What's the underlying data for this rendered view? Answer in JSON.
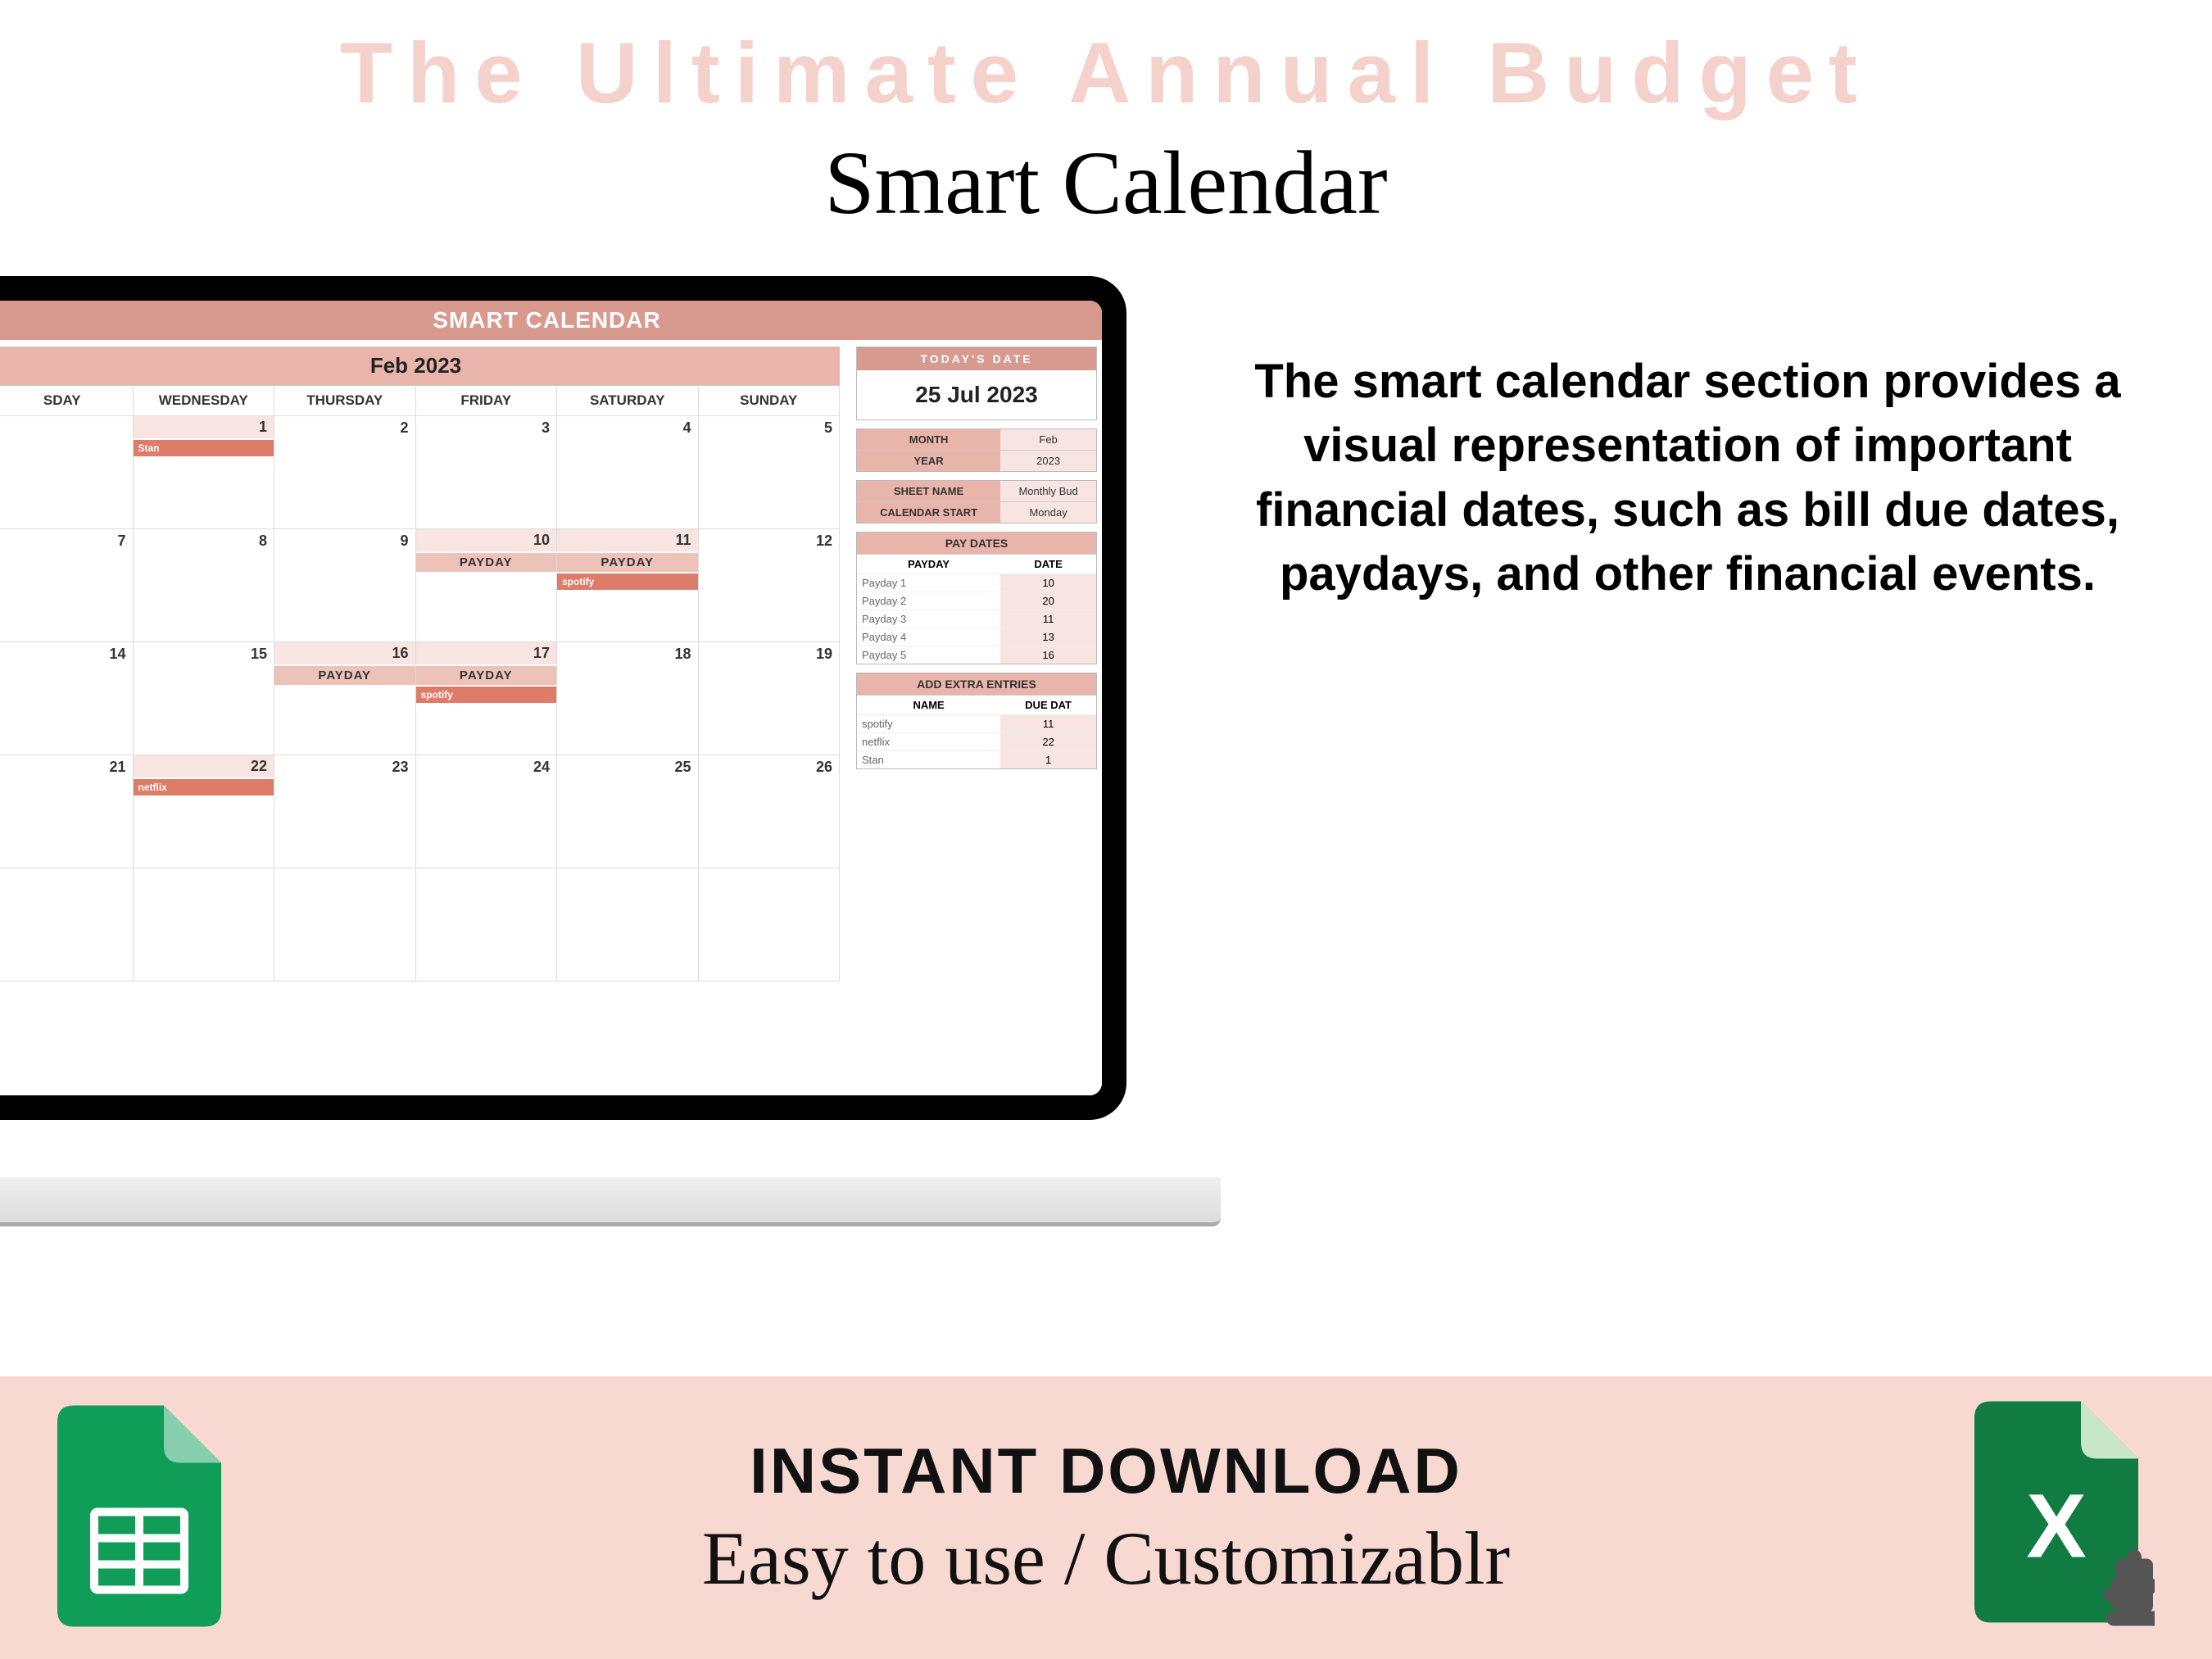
{
  "main_title": "The Ultimate Annual Budget",
  "subtitle": "Smart Calendar",
  "description": "The smart calendar section provides a visual representation of important financial dates, such as bill due dates, paydays, and other financial events.",
  "bottom": {
    "instant": "INSTANT DOWNLOAD",
    "easy": "Easy to use / Customizablr"
  },
  "calendar": {
    "banner": "SMART CALENDAR",
    "month_label": "Feb 2023",
    "day_headers": [
      "SDAY",
      "WEDNESDAY",
      "THURSDAY",
      "FRIDAY",
      "SATURDAY",
      "SUNDAY"
    ],
    "weeks": [
      [
        {
          "date": "",
          "tags": []
        },
        {
          "date": "1",
          "pink": true,
          "tags": [
            {
              "t": "Stan",
              "c": "stan"
            }
          ]
        },
        {
          "date": "2",
          "tags": []
        },
        {
          "date": "3",
          "tags": []
        },
        {
          "date": "4",
          "tags": []
        },
        {
          "date": "5",
          "tags": []
        }
      ],
      [
        {
          "date": "7",
          "tags": []
        },
        {
          "date": "8",
          "tags": []
        },
        {
          "date": "9",
          "tags": []
        },
        {
          "date": "10",
          "pink": true,
          "tags": [
            {
              "t": "PAYDAY",
              "c": "payday"
            }
          ]
        },
        {
          "date": "11",
          "pink": true,
          "tags": [
            {
              "t": "PAYDAY",
              "c": "payday"
            },
            {
              "t": "spotify",
              "c": "spotify"
            }
          ]
        },
        {
          "date": "12",
          "tags": []
        }
      ],
      [
        {
          "date": "14",
          "tags": []
        },
        {
          "date": "15",
          "tags": []
        },
        {
          "date": "16",
          "pink": true,
          "tags": [
            {
              "t": "PAYDAY",
              "c": "payday"
            }
          ]
        },
        {
          "date": "17",
          "pink": true,
          "tags": [
            {
              "t": "PAYDAY",
              "c": "payday"
            },
            {
              "t": "spotify",
              "c": "spotify"
            }
          ]
        },
        {
          "date": "18",
          "tags": []
        },
        {
          "date": "19",
          "tags": []
        }
      ],
      [
        {
          "date": "21",
          "tags": []
        },
        {
          "date": "22",
          "pink": true,
          "tags": [
            {
              "t": "netflix",
              "c": "netflix"
            }
          ]
        },
        {
          "date": "23",
          "tags": []
        },
        {
          "date": "24",
          "tags": []
        },
        {
          "date": "25",
          "tags": []
        },
        {
          "date": "26",
          "tags": []
        }
      ],
      [
        {
          "date": "",
          "tags": []
        },
        {
          "date": "",
          "tags": []
        },
        {
          "date": "",
          "tags": []
        },
        {
          "date": "",
          "tags": []
        },
        {
          "date": "",
          "tags": []
        },
        {
          "date": "",
          "tags": []
        }
      ]
    ]
  },
  "sidebar": {
    "today_title": "TODAY'S DATE",
    "today_value": "25 Jul 2023",
    "settings": [
      {
        "k": "MONTH",
        "v": "Feb"
      },
      {
        "k": "YEAR",
        "v": "2023"
      }
    ],
    "settings2": [
      {
        "k": "SHEET NAME",
        "v": "Monthly Bud"
      },
      {
        "k": "CALENDAR START",
        "v": "Monday"
      }
    ],
    "pay_title": "PAY DATES",
    "pay_head": {
      "a": "PAYDAY",
      "b": "DATE"
    },
    "pay_rows": [
      {
        "n": "Payday 1",
        "d": "10"
      },
      {
        "n": "Payday 2",
        "d": "20"
      },
      {
        "n": "Payday 3",
        "d": "11"
      },
      {
        "n": "Payday 4",
        "d": "13"
      },
      {
        "n": "Payday 5",
        "d": "16"
      }
    ],
    "extra_title": "ADD EXTRA ENTRIES",
    "extra_head": {
      "a": "NAME",
      "b": "DUE DAT"
    },
    "extra_rows": [
      {
        "n": "spotify",
        "d": "11"
      },
      {
        "n": "netflix",
        "d": "22"
      },
      {
        "n": "Stan",
        "d": "1"
      }
    ]
  }
}
